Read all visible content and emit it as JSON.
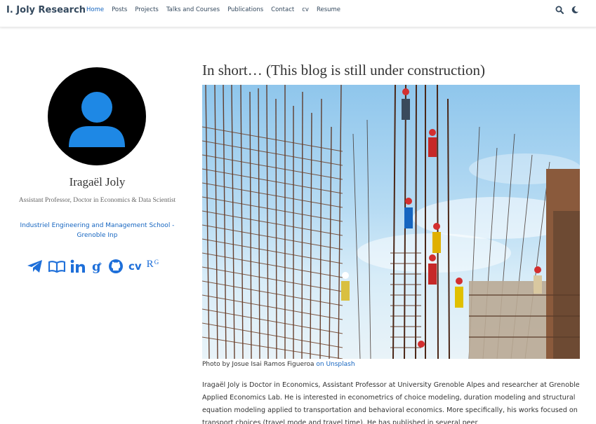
{
  "navbar": {
    "brand": "I. Joly Research",
    "items": [
      "Home",
      "Posts",
      "Projects",
      "Talks and Courses",
      "Publications",
      "Contact",
      "cv",
      "Resume"
    ],
    "active_item": "Home",
    "icons": [
      "search-icon",
      "moon-icon"
    ]
  },
  "profile": {
    "name": "Iragaël Joly",
    "role": "Assistant Professor, Doctor in Economics & Data Scientist",
    "org": "Industriel Engineering and Management School - Grenoble Inp",
    "socials": [
      "telegram-icon",
      "book-icon",
      "linkedin-icon",
      "google-scholar-icon",
      "github-icon",
      "cv-icon",
      "researchgate-icon"
    ],
    "cv_label": "cv",
    "rg_label": "RG"
  },
  "main": {
    "title": "In short… (This blog is still under construction)",
    "caption_prefix": "Photo by Josue Isai Ramos Figueroa",
    "caption_link": "on Unsplash",
    "bio": "Iragaël Joly is Doctor in Economics, Assistant Professor at University Grenoble Alpes and researcher at Grenoble Applied Economics Lab. He is interested in econometrics of choice modeling, duration modeling and structural equation modeling applied to transportation and behavioral economics. More specifically, his works focused on transport choices (travel mode and travel time). He has published in several peer"
  },
  "colors": {
    "accent": "#1565c0",
    "social": "#1e6fd9",
    "avatar_bg": "#000000",
    "avatar_figure": "#1e88e5"
  }
}
